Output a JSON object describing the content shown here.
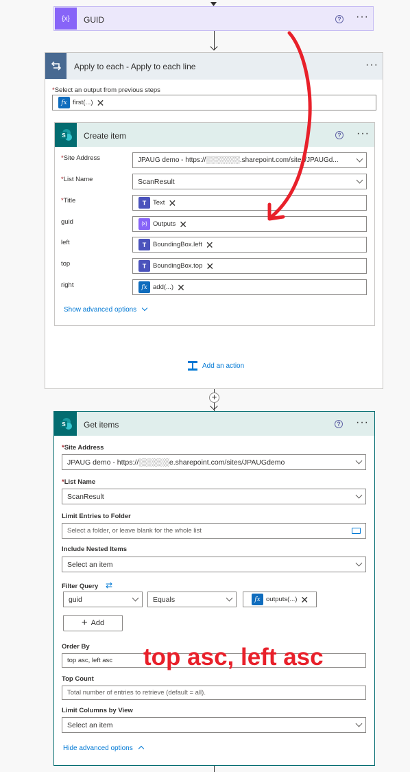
{
  "guid_step": {
    "title": "GUID"
  },
  "apply_each": {
    "title": "Apply to each - Apply to each line",
    "select_label": "Select an output from previous steps",
    "select_token": "first(...)"
  },
  "create_item": {
    "title": "Create item",
    "fields": [
      {
        "label": "Site Address",
        "required": true,
        "value": "JPAUG demo - https://░░░░░░░.sharepoint.com/sites/JPAUGd..."
      },
      {
        "label": "List Name",
        "required": true,
        "value": "ScanResult"
      },
      {
        "label": "Title",
        "required": true,
        "token": "Text"
      },
      {
        "label": "guid",
        "required": false,
        "token": "Outputs"
      },
      {
        "label": "left",
        "required": false,
        "token": "BoundingBox.left"
      },
      {
        "label": "top",
        "required": false,
        "token": "BoundingBox.top"
      },
      {
        "label": "right",
        "required": false,
        "token": "add(...)"
      }
    ],
    "show_advanced": "Show advanced options"
  },
  "add_action": "Add an action",
  "get_items": {
    "title": "Get items",
    "site_label": "Site Address",
    "site_value": "JPAUG demo - https://░░░░░░e.sharepoint.com/sites/JPAUGdemo",
    "list_label": "List Name",
    "list_value": "ScanResult",
    "folder_label": "Limit Entries to Folder",
    "folder_placeholder": "Select a folder, or leave blank for the whole list",
    "nested_label": "Include Nested Items",
    "nested_value": "Select an item",
    "filter_label": "Filter Query",
    "filter_field": "guid",
    "filter_op": "Equals",
    "filter_token": "outputs(...)",
    "add_label": "Add",
    "order_label": "Order By",
    "order_value": "top asc, left asc",
    "top_label": "Top Count",
    "top_placeholder": "Total number of entries to retrieve (default = all).",
    "columns_label": "Limit Columns by View",
    "columns_value": "Select an item",
    "hide_advanced": "Hide advanced options"
  },
  "annotation": "top asc, left asc",
  "colors": {
    "red": "#e8202a",
    "sharepoint": "#036c70",
    "teams": "#4b53bc",
    "expression": "#0f6cbd",
    "variable": "#8764f8"
  }
}
